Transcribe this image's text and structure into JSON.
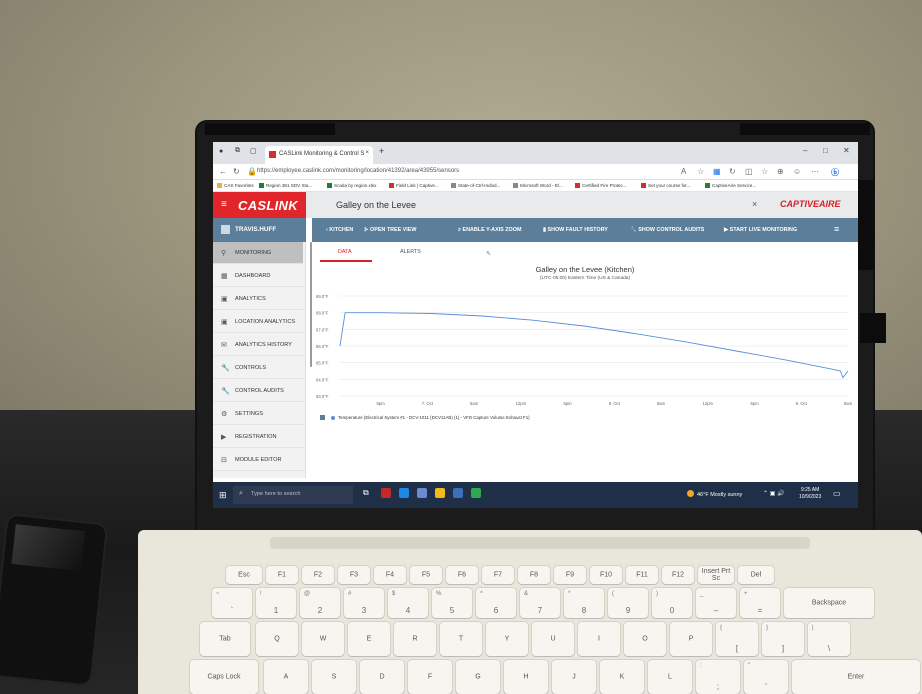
{
  "browser": {
    "tab_title": "CASLink Monitoring & Control S",
    "tab_close": "×",
    "new_tab": "+",
    "url": "https://employee.caslink.com/monitoring/location/41392/area/43955/sensors",
    "win_minimize": "–",
    "win_maximize": "□",
    "win_close": "✕",
    "favorites": [
      "CAS Favorites",
      "Region 361 SDV Sta...",
      "Scada by region.xlsx",
      "Field Link | Captive...",
      "State-of-Ctrl-Indivd...",
      "Microsoft Word - El...",
      "Certified Fire Protec...",
      "Set your course for...",
      "CaptiveAire Service..."
    ]
  },
  "app": {
    "logo": "CASLINK",
    "site_name": "Galley on the Levee",
    "close_label": "×",
    "partner_logo": "CAPTIVEAIRE",
    "user": "TRAVIS.HUFF",
    "sidebar": [
      {
        "label": "MONITORING",
        "icon": "antenna-icon"
      },
      {
        "label": "DASHBOARD",
        "icon": "grid-icon"
      },
      {
        "label": "ANALYTICS",
        "icon": "chart-icon"
      },
      {
        "label": "LOCATION ANALYTICS",
        "icon": "chart-icon"
      },
      {
        "label": "ANALYTICS HISTORY",
        "icon": "mail-icon"
      },
      {
        "label": "CONTROLS",
        "icon": "wrench-icon"
      },
      {
        "label": "CONTROL AUDITS",
        "icon": "wrench-icon"
      },
      {
        "label": "SETTINGS",
        "icon": "gear-icon"
      },
      {
        "label": "REGISTRATION",
        "icon": "tag-icon"
      },
      {
        "label": "MODULE EDITOR",
        "icon": "module-icon"
      }
    ],
    "toolbar": {
      "back": "KITCHEN",
      "tree": "OPEN TREE VIEW",
      "zoom": "ENABLE Y-AXIS ZOOM",
      "fault": "SHOW FAULT HISTORY",
      "audits": "SHOW CONTROL AUDITS",
      "live": "START LIVE MONITORING"
    },
    "tabs": [
      "DATA",
      "ALERTS"
    ]
  },
  "chart_data": {
    "type": "line",
    "title": "Galley on the Levee (Kitchen)",
    "subtitle": "(UTC-05:00) Eastern Time (US & Canada)",
    "ylabels": [
      "69.0°F",
      "68.0°F",
      "67.0°F",
      "66.0°F",
      "65.0°F",
      "64.0°F",
      "63.0°F"
    ],
    "ylim": [
      63.0,
      69.0
    ],
    "xlabels": [
      "6pm",
      "7. Oct",
      "6am",
      "12pm",
      "6pm",
      "8. Oct",
      "6am",
      "12pm",
      "6pm",
      "9. Oct",
      "6am"
    ],
    "series": [
      {
        "name": "Temperature (Electrical System #1 - DCV-1011 (DCV11AB) (1) - VFD Capture Volume Exhaust F1)",
        "color": "#5b8fd9",
        "points": [
          [
            0,
            66.0
          ],
          [
            0.01,
            68.0
          ],
          [
            0.08,
            68.0
          ],
          [
            0.18,
            67.95
          ],
          [
            0.28,
            67.8
          ],
          [
            0.38,
            67.55
          ],
          [
            0.48,
            67.2
          ],
          [
            0.58,
            66.75
          ],
          [
            0.68,
            66.25
          ],
          [
            0.78,
            65.7
          ],
          [
            0.88,
            65.15
          ],
          [
            0.97,
            64.6
          ],
          [
            0.985,
            64.5
          ],
          [
            0.99,
            64.1
          ],
          [
            1.0,
            64.5
          ]
        ]
      }
    ],
    "grid": true,
    "legend": "bottom-left"
  },
  "taskbar": {
    "search_placeholder": "Type here to search",
    "weather": "46°F Mostly sunny",
    "time": "9:25 AM",
    "date": "10/9/2023"
  },
  "keyboard": {
    "row1": [
      "Esc",
      "F1",
      "F2",
      "F3",
      "F4",
      "F5",
      "F6",
      "F7",
      "F8",
      "F9",
      "F10",
      "F11",
      "F12",
      "Insert Prt Sc",
      "Del"
    ],
    "row2": [
      [
        "~",
        "`"
      ],
      [
        "!",
        "1"
      ],
      [
        "@",
        "2"
      ],
      [
        "#",
        "3"
      ],
      [
        "$",
        "4"
      ],
      [
        "%",
        "5"
      ],
      [
        "^",
        "6"
      ],
      [
        "&",
        "7"
      ],
      [
        "*",
        "8"
      ],
      [
        "(",
        "9"
      ],
      [
        ")",
        "0"
      ],
      [
        "_",
        "–"
      ],
      [
        "+",
        "="
      ]
    ],
    "backspace": "Backspace",
    "tab": "Tab",
    "row3": [
      "Q",
      "W",
      "E",
      "R",
      "T",
      "Y",
      "U",
      "I",
      "O",
      "P"
    ],
    "row3_extra": [
      [
        "{",
        "["
      ],
      [
        "}",
        "]"
      ],
      [
        "|",
        "\\"
      ]
    ],
    "caps": "Caps Lock",
    "row4": [
      "A",
      "S",
      "D",
      "F",
      "G",
      "H",
      "J",
      "K",
      "L"
    ],
    "row4_extra": [
      [
        ":",
        ";"
      ],
      [
        "\"",
        "'"
      ]
    ],
    "enter": "Enter"
  }
}
